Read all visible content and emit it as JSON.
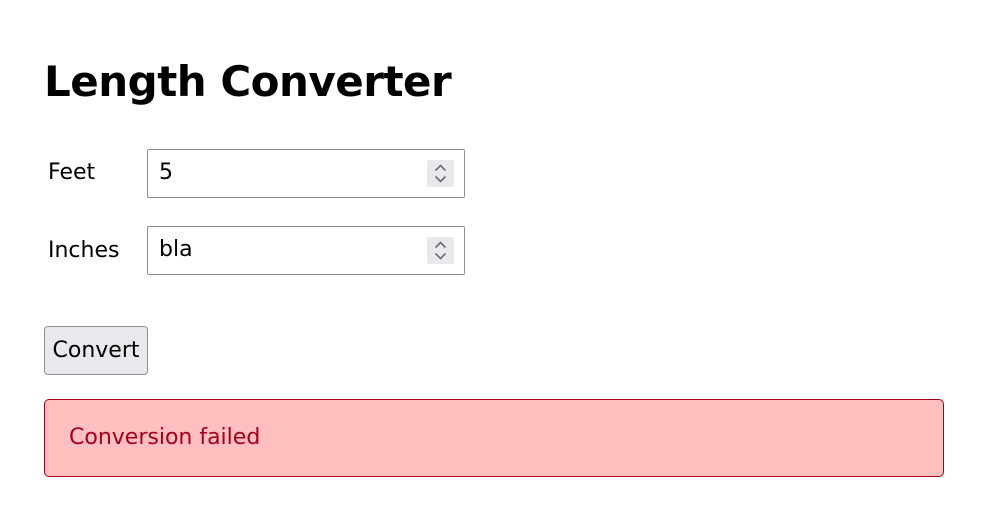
{
  "page": {
    "title": "Length Converter"
  },
  "form": {
    "feet": {
      "label": "Feet",
      "value": "5"
    },
    "inches": {
      "label": "Inches",
      "value": "bla"
    },
    "convert_label": "Convert"
  },
  "status": {
    "error_message": "Conversion failed"
  },
  "icons": {
    "spinner": "up-down-chevron-icon"
  },
  "colors": {
    "error_background": "#ffbfbf",
    "error_text": "#a4001d",
    "error_border": "#a4001d",
    "button_background": "#e9e9ed"
  }
}
